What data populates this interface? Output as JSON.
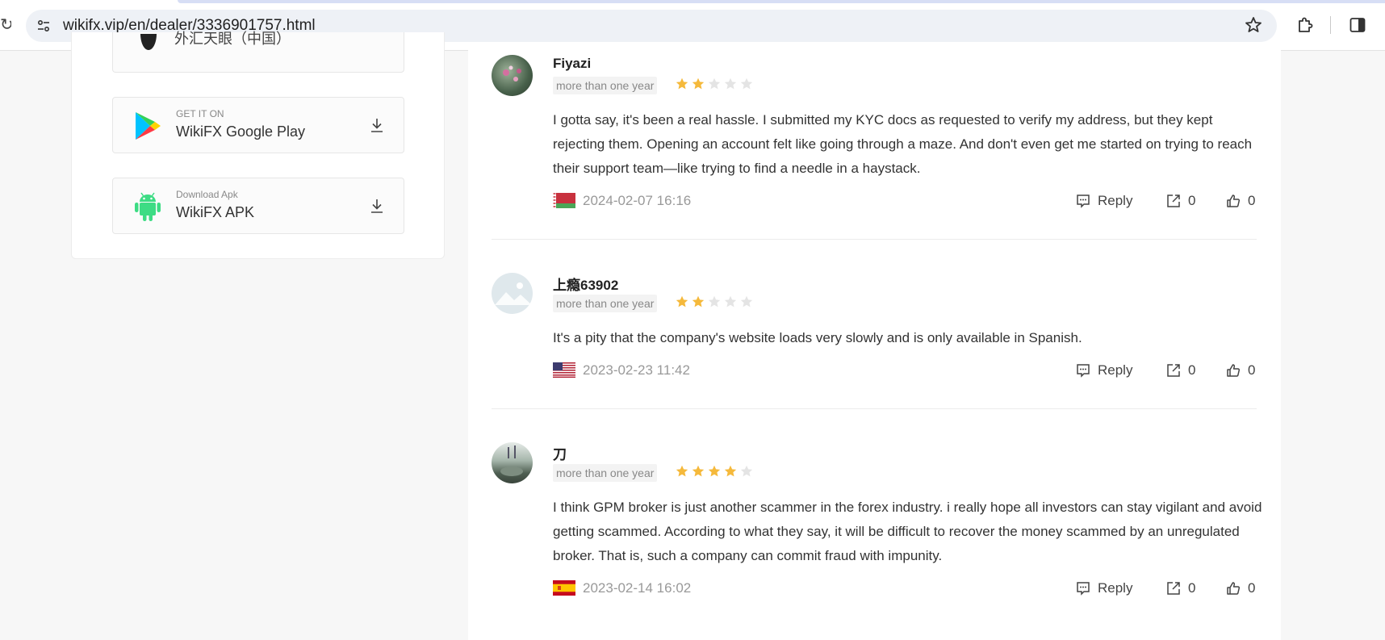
{
  "browser": {
    "url": "wikifx.vip/en/dealer/3336901757.html"
  },
  "downloads": {
    "top_partial_label": "外汇天眼（中国）",
    "google": {
      "small": "GET IT ON",
      "big": "WikiFX Google Play"
    },
    "apk": {
      "small": "Download Apk",
      "big": "WikiFX APK"
    }
  },
  "reviews": [
    {
      "name": "Fiyazi",
      "tag": "more than one year",
      "rating": 2,
      "text": "I gotta say, it's been a real hassle. I submitted my KYC docs as requested to verify my address, but they kept rejecting them. Opening an account felt like going through a maze. And don't even get me started on trying to reach their support team—like trying to find a needle in a haystack.",
      "flag": "belarus",
      "date": "2024-02-07 16:16",
      "reply_label": "Reply",
      "shares": "0",
      "likes": "0"
    },
    {
      "name": "上瘾63902",
      "tag": "more than one year",
      "rating": 2,
      "text": "It's a pity that the company's website loads very slowly and is only available in Spanish.",
      "flag": "usa",
      "date": "2023-02-23 11:42",
      "reply_label": "Reply",
      "shares": "0",
      "likes": "0"
    },
    {
      "name": "刀",
      "tag": "more than one year",
      "rating": 4,
      "text": "I think GPM broker is just another scammer in the forex industry. i really hope all investors can stay vigilant and avoid getting scammed. According to what they say, it will be difficult to recover the money scammed by an unregulated broker. That is, such a company can commit fraud with impunity.",
      "flag": "spain",
      "date": "2023-02-14 16:02",
      "reply_label": "Reply",
      "shares": "0",
      "likes": "0"
    }
  ],
  "colors": {
    "star_on": "#f5b93b",
    "star_off": "#e4e4e4"
  }
}
